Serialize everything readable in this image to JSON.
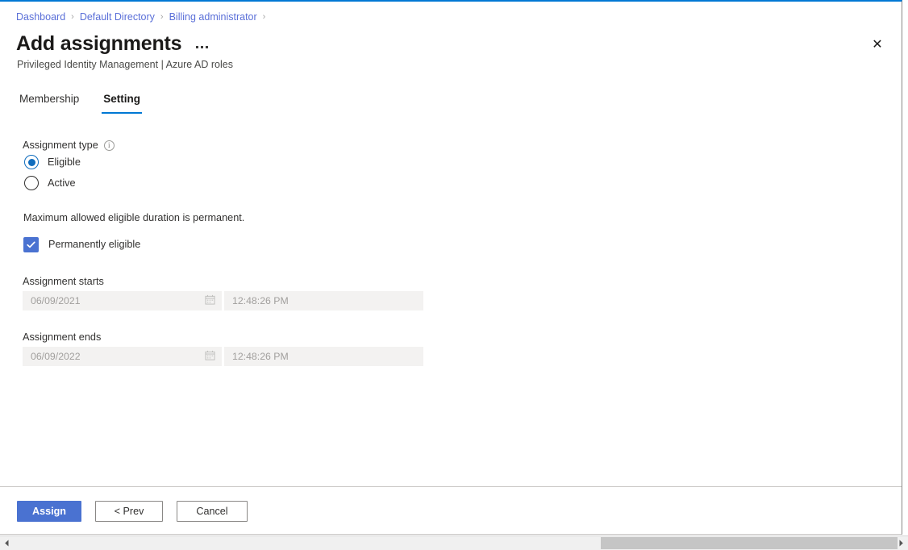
{
  "breadcrumb": {
    "items": [
      {
        "label": "Dashboard"
      },
      {
        "label": "Default Directory"
      },
      {
        "label": "Billing administrator"
      }
    ],
    "separator": "›"
  },
  "header": {
    "title": "Add assignments",
    "subtitle": "Privileged Identity Management | Azure AD roles",
    "more_menu_name": "more-options",
    "close_label": "✕"
  },
  "tabs": [
    {
      "label": "Membership",
      "active": false
    },
    {
      "label": "Setting",
      "active": true
    }
  ],
  "form": {
    "assignment_type": {
      "label": "Assignment type",
      "info_glyph": "i",
      "options": [
        {
          "label": "Eligible",
          "selected": true
        },
        {
          "label": "Active",
          "selected": false
        }
      ]
    },
    "duration_note": "Maximum allowed eligible duration is permanent.",
    "permanently_eligible": {
      "label": "Permanently eligible",
      "checked": true
    },
    "assignment_starts": {
      "label": "Assignment starts",
      "date_value": "06/09/2021",
      "time_value": "12:48:26 PM",
      "disabled": true
    },
    "assignment_ends": {
      "label": "Assignment ends",
      "date_value": "06/09/2022",
      "time_value": "12:48:26 PM",
      "disabled": true
    }
  },
  "footer": {
    "assign_label": "Assign",
    "prev_label": "< Prev",
    "cancel_label": "Cancel"
  },
  "scrollbar": {
    "left_arrow": "◀",
    "right_arrow": "▶"
  },
  "colors": {
    "accent_blue": "#0078d4",
    "primary_button": "#4a72d1",
    "link_blue": "#5a6fd8",
    "radio_selected": "#0f6cbd",
    "disabled_text": "#a19f9d",
    "disabled_field_bg": "#f3f2f1"
  }
}
